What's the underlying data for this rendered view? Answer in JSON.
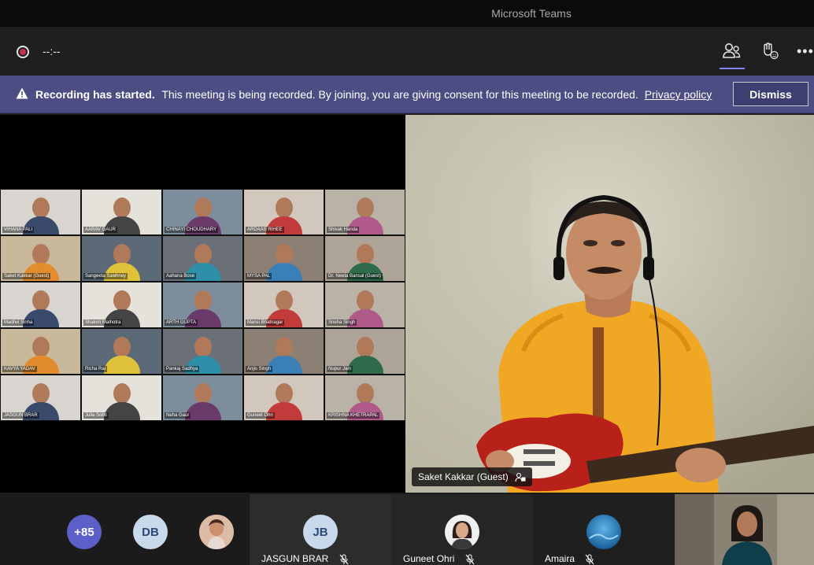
{
  "window": {
    "title": "Microsoft Teams"
  },
  "toolbar": {
    "timer": "--:--",
    "buttons": [
      "people-icon",
      "raise-hand-icon",
      "more-options-icon"
    ]
  },
  "banner": {
    "heading": "Recording has started.",
    "message": "This meeting is being recorded. By joining, you are giving consent for this meeting to be recorded.",
    "link": "Privacy policy",
    "dismiss": "Dismiss"
  },
  "shared_grid": [
    "VIHANA PALI",
    "AARAV GAUR",
    "CHINAYI CHOUDHARY",
    "ARDAAS RIHEE",
    "Shivak Handa",
    "Saket Kakkar (Guest)",
    "Sangeeta Sawhney",
    "Aahana Bose",
    "MYSA PAL",
    "Dr. Neeta Bansal (Guest)",
    "Madhvi Sinha",
    "Shalom Malhotra",
    "ARTH GUPTA",
    "Mansi Bhatnagar",
    "Sneha Singh",
    "KAVYA YADAV",
    "Richa Rai",
    "Pankaj Sadhya",
    "Anjis Singh",
    "Nupur Jain",
    "JASGUN BRAR",
    "Julia Sobti",
    "Neha Gaur",
    "Guneet Ohri",
    "KRISHNA KHETRAPAL"
  ],
  "main_video": {
    "name": "Saket Kakkar (Guest)"
  },
  "participants_strip": {
    "overflow_count": "+85",
    "db_initials": "DB",
    "tiles": [
      {
        "initials": "JB",
        "name": "JASGUN BRAR",
        "muted": true
      },
      {
        "initials": "",
        "name": "Guneet Ohri",
        "muted": true
      },
      {
        "initials": "",
        "name": "Amaira",
        "muted": true
      }
    ]
  },
  "colors": {
    "accent": "#7f85f5",
    "banner": "#4b4d83",
    "record": "#c4314b",
    "avatar_overflow": "#5b5fc7"
  }
}
